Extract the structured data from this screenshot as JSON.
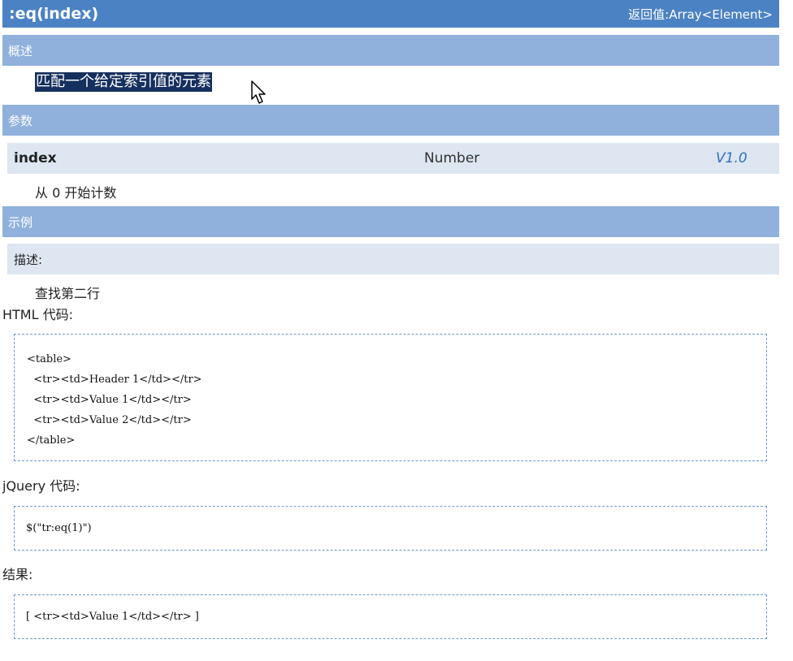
{
  "title_bar": {
    "title": ":eq(index)",
    "return_value": "返回值:Array<Element>"
  },
  "overview": {
    "header": "概述",
    "description": "匹配一个给定索引值的元素"
  },
  "params": {
    "header": "参数",
    "name": "index",
    "type": "Number",
    "version": "V1.0",
    "description": "从 0 开始计数"
  },
  "example": {
    "header": "示例",
    "desc_label": "描述:",
    "desc_text": "查找第二行",
    "html_label": "HTML 代码:",
    "html_code": [
      "<table>",
      "  <tr><td>Header 1</td></tr>",
      "  <tr><td>Value 1</td></tr>",
      "  <tr><td>Value 2</td></tr>",
      "</table>"
    ],
    "jquery_label": "jQuery 代码:",
    "jquery_code": "$(\"tr:eq(1)\")",
    "result_label": "结果:",
    "result_code": "[ <tr><td>Value 1</td></tr> ]"
  },
  "colors": {
    "title_bar": "#4b82c4",
    "section_header": "#8fb1dc",
    "row_background": "#dde6f1",
    "selection": "#16305e",
    "version_text": "#2f6fc0",
    "code_border": "#6f96cc"
  },
  "icons": {
    "cursor": "mouse-pointer-arrow"
  }
}
